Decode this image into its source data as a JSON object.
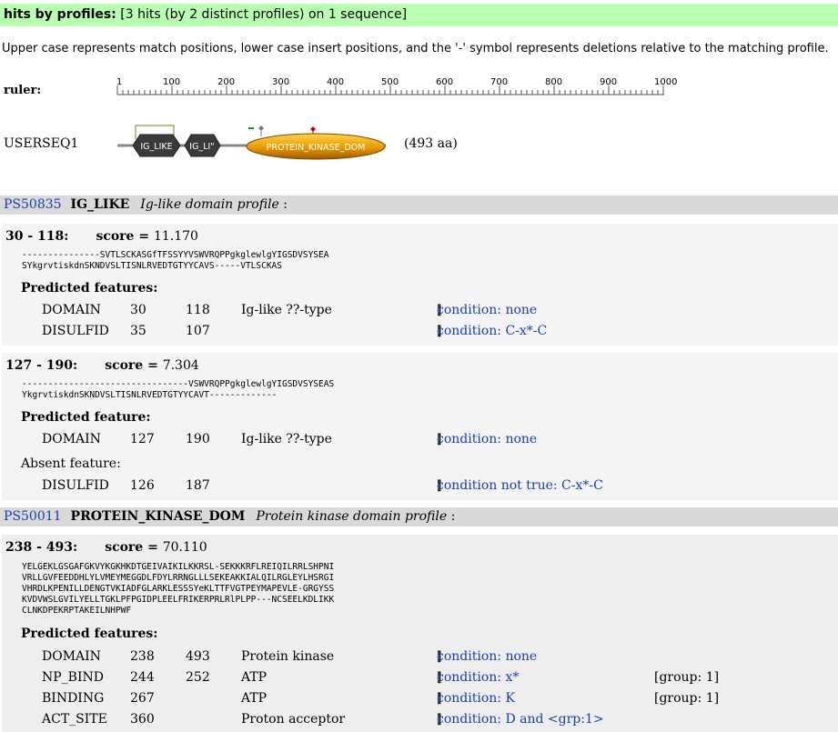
{
  "header": {
    "title": "hits by profiles:",
    "summary": "[3 hits (by 2 distinct profiles) on 1 sequence]"
  },
  "legend_note": "Upper case represents match positions, lower case insert positions, and the '-' symbol represents deletions relative to the matching profile.",
  "ruler": {
    "label": "ruler:",
    "ticks": [
      "1",
      "100",
      "200",
      "300",
      "400",
      "500",
      "600",
      "700",
      "800",
      "900",
      "1000"
    ]
  },
  "sequence": {
    "name": "USERSEQ1",
    "length_text": "(493 aa)",
    "domain_labels": [
      "IG_LIKE",
      "IG_LI\"",
      "PROTEIN_KINASE_DOM"
    ]
  },
  "colors": {
    "header_bg": "#b8ffb2",
    "profile_bar_bg": "#d9d9d9",
    "link": "#1a3fb0",
    "ig_like_domain": "#3a3a3a",
    "kinase_domain": "#e89a00"
  },
  "profiles": [
    {
      "accession": "PS50835",
      "name": "IG_LIKE",
      "description": "Ig-like domain profile",
      "hits": [
        {
          "range": "30 - 118:",
          "score_label": "score =",
          "score": "11.170",
          "alignment": [
            "---------------SVTLSCKASGfTFSSYYVSWVRQPPgkglewlgYIGSDVSYSEA",
            "SYkgrvtiskdnSKNDVSLTISNLRVEDTGTYYCAVS-----VTLSCKAS"
          ],
          "features_heading": "Predicted features:",
          "features": [
            {
              "type": "DOMAIN",
              "from": "30",
              "to": "118",
              "desc": "Ig-like ??-type",
              "cond": "condition: none",
              "group": ""
            },
            {
              "type": "DISULFID",
              "from": "35",
              "to": "107",
              "desc": "",
              "cond": "condition: C-x*-C",
              "group": ""
            }
          ]
        },
        {
          "range": "127 - 190:",
          "score_label": "score =",
          "score": "7.304",
          "alignment": [
            "--------------------------------VSWVRQPPgkglewlgYIGSDVSYSEAS",
            "YkgrvtiskdnSKNDVSLTISNLRVEDTGTYYCAVT-------------"
          ],
          "features_heading": "Predicted feature:",
          "features": [
            {
              "type": "DOMAIN",
              "from": "127",
              "to": "190",
              "desc": "Ig-like ??-type",
              "cond": "condition: none",
              "group": ""
            }
          ],
          "absent_heading": "Absent feature:",
          "absent_features": [
            {
              "type": "DISULFID",
              "from": "126",
              "to": "187",
              "desc": "",
              "cond": "condition not true: C-x*-C",
              "group": ""
            }
          ]
        }
      ]
    },
    {
      "accession": "PS50011",
      "name": "PROTEIN_KINASE_DOM",
      "description": "Protein kinase domain profile",
      "hits": [
        {
          "range": "238 - 493:",
          "score_label": "score =",
          "score": "70.110",
          "alignment": [
            "YELGEKLGSGAFGKVYKGKHKDTGEIVAIKILKKRSL-SEKKKRFLREIQILRRLSHPNI",
            "VRLLGVFEEDDHLYLVMEYMEGGDLFDYLRRNGLLLSEKEAKKIALQILRGLEYLHSRGI",
            "VHRDLKPENILLDENGTVKIADFGLARKLESSSYeKLTTFVGTPEYMAPEVLE-GRGYSS",
            "KVDVWSLGVILYELLTGKLPFPGIDPLEELFRIKERPRLRlPLPP---NCSEELKDLIKK",
            "CLNKDPEKRPTAKEILNHPWF"
          ],
          "features_heading": "Predicted features:",
          "features": [
            {
              "type": "DOMAIN",
              "from": "238",
              "to": "493",
              "desc": "Protein kinase",
              "cond": "condition: none",
              "group": ""
            },
            {
              "type": "NP_BIND",
              "from": "244",
              "to": "252",
              "desc": "ATP",
              "cond": "condition: x*",
              "group": "[group: 1]"
            },
            {
              "type": "BINDING",
              "from": "267",
              "to": "",
              "desc": "ATP",
              "cond": "condition: K",
              "group": "[group: 1]"
            },
            {
              "type": "ACT_SITE",
              "from": "360",
              "to": "",
              "desc": "Proton acceptor",
              "cond": "condition: D and <grp:1>",
              "group": ""
            }
          ]
        }
      ]
    }
  ]
}
